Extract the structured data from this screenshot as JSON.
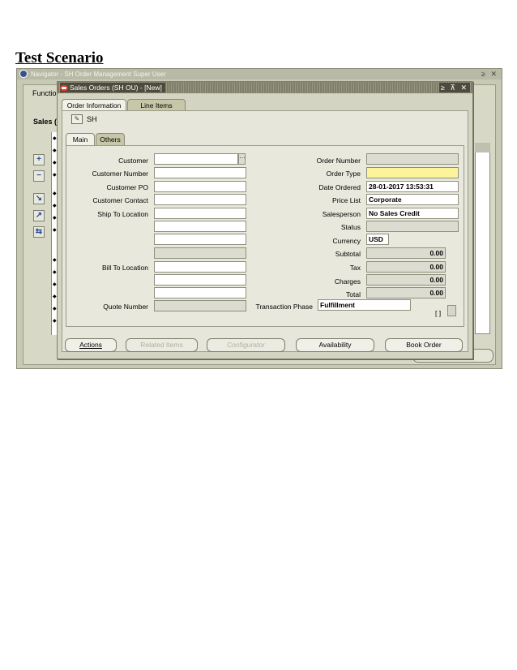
{
  "doc": {
    "title": "Test Scenario"
  },
  "navigator": {
    "title": "Navigator - SH Order Management Super User",
    "controls": "≥ ✕",
    "tab_label": "Functio",
    "sales_label": "Sales (",
    "side_buttons": [
      "+",
      "−",
      "↘",
      "↗",
      "⇆"
    ]
  },
  "sales_order": {
    "window_title": "Sales Orders (SH OU) - [New]",
    "window_controls": "≥ ⊼ ✕",
    "tabs": [
      "Order Information",
      "Line Items"
    ],
    "operating_unit": "SH",
    "subtabs": [
      "Main",
      "Others"
    ],
    "left_fields": {
      "customer_label": "Customer",
      "customer_number_label": "Customer Number",
      "customer_po_label": "Customer PO",
      "customer_contact_label": "Customer Contact",
      "ship_to_label": "Ship To Location",
      "bill_to_label": "Bill To Location",
      "quote_number_label": "Quote Number"
    },
    "right_fields": {
      "order_number_label": "Order Number",
      "order_type_label": "Order Type",
      "date_ordered_label": "Date Ordered",
      "date_ordered_value": "28-01-2017 13:53:31",
      "price_list_label": "Price List",
      "price_list_value": "Corporate",
      "salesperson_label": "Salesperson",
      "salesperson_value": "No Sales Credit",
      "status_label": "Status",
      "currency_label": "Currency",
      "currency_value": "USD",
      "subtotal_label": "Subtotal",
      "subtotal_value": "0.00",
      "tax_label": "Tax",
      "tax_value": "0.00",
      "charges_label": "Charges",
      "charges_value": "0.00",
      "total_label": "Total",
      "total_value": "0.00",
      "transaction_phase_label": "Transaction Phase",
      "transaction_phase_value": "Fulfillment",
      "bracket_text": "[ ]"
    },
    "buttons": {
      "actions": "Actions",
      "related_items": "Related Items",
      "configurator": "Configurator",
      "availability": "Availability",
      "book_order": "Book Order"
    }
  }
}
